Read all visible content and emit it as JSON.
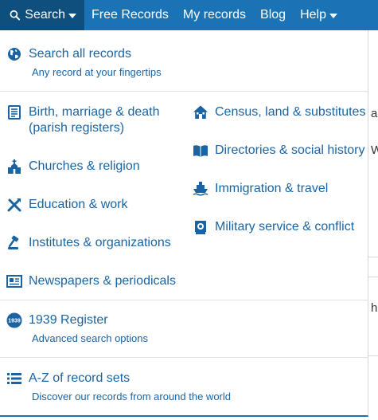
{
  "nav": {
    "search": "Search",
    "free_records": "Free Records",
    "my_records": "My records",
    "blog": "Blog",
    "help": "Help"
  },
  "menu": {
    "search_all": {
      "label": "Search all records",
      "sub": "Any record at your fingertips"
    },
    "left": [
      {
        "label": "Birth, marriage & death\n(parish registers)"
      },
      {
        "label": "Churches & religion"
      },
      {
        "label": "Education & work"
      },
      {
        "label": "Institutes & organizations"
      },
      {
        "label": "Newspapers & periodicals"
      }
    ],
    "right": [
      {
        "label": "Census, land & substitutes"
      },
      {
        "label": "Directories & social history"
      },
      {
        "label": "Immigration & travel"
      },
      {
        "label": "Military service & conflict"
      }
    ],
    "register_1939": {
      "label": "1939 Register",
      "sub": "Advanced search options"
    },
    "az": {
      "label": "A-Z of record sets",
      "sub": "Discover our records from around the world"
    }
  },
  "icons": {
    "search_all": "globe-icon",
    "birth": "document-list-icon",
    "churches": "church-icon",
    "education": "tools-icon",
    "institutes": "gavel-icon",
    "newspapers": "newspaper-icon",
    "census": "house-icon",
    "directories": "book-icon",
    "immigration": "ship-icon",
    "military": "medal-icon",
    "register": "1939-badge-icon",
    "az": "list-icon"
  },
  "colors": {
    "nav_bg": "#1a73b5",
    "nav_active": "#0e4f7d",
    "link": "#1a64a4"
  },
  "background_text": {
    "a": "a",
    "w": "W",
    "h": "h"
  }
}
